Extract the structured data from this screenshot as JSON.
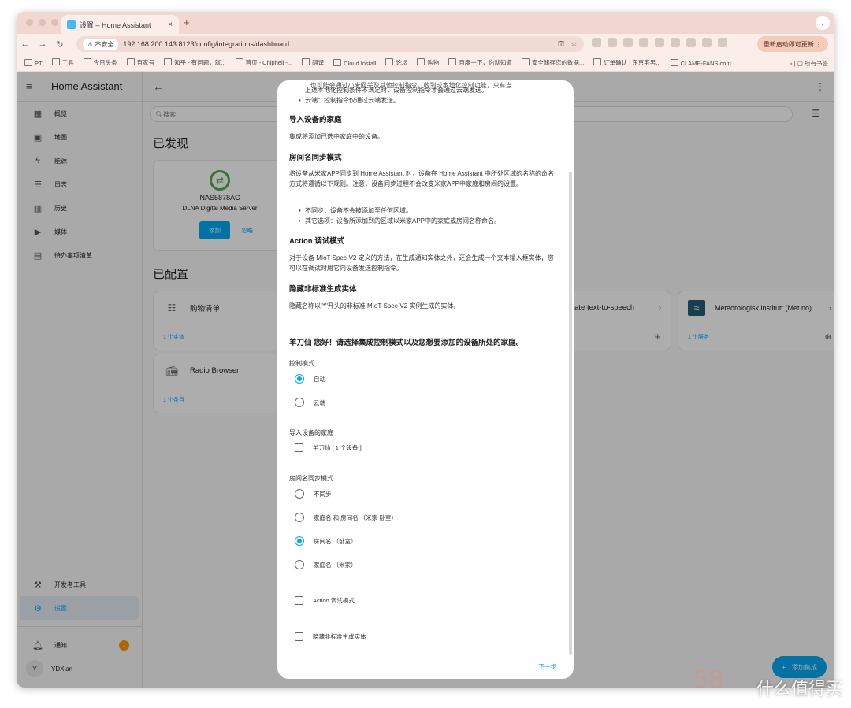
{
  "browser": {
    "tab_title": "设置 – Home Assistant",
    "tab_close": "×",
    "new_tab": "+",
    "insecure_label": "不安全",
    "url": "192.168.200.143:8123/config/integrations/dashboard",
    "relaunch_label": "重新启动即可更新",
    "bookmarks": [
      "PT",
      "工具",
      "今日头条",
      "百家号",
      "知乎 - 有问题，就...",
      "首页 - Chiphell -...",
      "翻译",
      "Cloud Install",
      "论坛",
      "购物",
      "百度一下，你就知道",
      "安全储存您的数据...",
      "订单确认 | 东京宅男...",
      "CLAMP-FANS.com..."
    ],
    "bookmarks_more": "»",
    "all_bookmarks": "所有书签"
  },
  "sidebar": {
    "title": "Home Assistant",
    "items": [
      {
        "label": "概览",
        "icon": "▦"
      },
      {
        "label": "地图",
        "icon": "▣"
      },
      {
        "label": "能源",
        "icon": "ϟ"
      },
      {
        "label": "日志",
        "icon": "☰"
      },
      {
        "label": "历史",
        "icon": "▥"
      },
      {
        "label": "媒体",
        "icon": "▶"
      },
      {
        "label": "待办事项清单",
        "icon": "▤"
      }
    ],
    "dev_tools": "开发者工具",
    "settings": "设置",
    "notifications": "通知",
    "notification_count": "1",
    "user_initial": "Y",
    "user_name": "YDXian"
  },
  "main": {
    "search_placeholder": "搜索",
    "discovered_title": "已发现",
    "configured_title": "已配置",
    "discovered_card": {
      "name": "NAS5878AC",
      "subtitle": "DLNA Digital Media Server",
      "add_label": "添加",
      "ignore_label": "忽略"
    },
    "cards": [
      {
        "name": "购物清单",
        "footer": "1 个实体"
      },
      {
        "name": "Radio Browser",
        "footer": "1 个条目"
      },
      {
        "name": "late text-to-speech",
        "footer": ""
      },
      {
        "name": "Meteorologisk institutt (Met.no)",
        "footer": "1 个服务"
      }
    ],
    "fab_label": "添加集成"
  },
  "dialog": {
    "top_line1": "...也可能会通过小米网关及其他控制指令，收到或本地化控制功能，只有当",
    "top_line2": "上述本地化控制条件不满足时，设备控制指令才会通过云端发送。",
    "top_bullet": "云端：控制指令仅通过云端发送。",
    "sec1_title": "导入设备的家庭",
    "sec1_text": "集成将添加已选中家庭中的设备。",
    "sec2_title": "房间名同步模式",
    "sec2_text": "将设备从米家APP同步到 Home Assistant 时，设备在 Home Assistant 中所处区域的名称的命名方式将遵循以下规则。注意，设备同步过程不会改变米家APP中家庭和房间的设置。",
    "sec2_b1": "不同步：设备不会被添加至任何区域。",
    "sec2_b2": "其它选项：设备所添加到的区域以米家APP中的家庭或房间名称命名。",
    "sec3_title": "Action 调试模式",
    "sec3_text": "对于设备 MIoT-Spec-V2 定义的方法，在生成通知实体之外，还会生成一个文本输入框实体，您可以在调试时用它向设备发送控制指令。",
    "sec4_title": "隐藏非标准生成实体",
    "sec4_text": "隐藏名称以\"*\"开头的非标准 MIoT-Spec-V2 实例生成的实体。",
    "greeting": "羊刀仙 您好！请选择集成控制模式以及您想要添加的设备所处的家庭。",
    "control_mode_label": "控制模式",
    "control_auto": "自动",
    "control_cloud": "云端",
    "home_label": "导入设备的家庭",
    "home_option": "羊刀仙 [ 1 个设备 ]",
    "room_label": "房间名同步模式",
    "room_none": "不同步",
    "room_home_room": "家庭名 和 房间名 （米家 卧室）",
    "room_room": "房间名 （卧室）",
    "room_home": "家庭名 （米家）",
    "action_debug": "Action 调试模式",
    "hide_nonstd": "隐藏非标准生成实体",
    "next_label": "下一步"
  },
  "watermark": {
    "text": "什么值得买",
    "num": "58"
  },
  "colors": {
    "accent": "#03a9f4",
    "badge": "#ff9800",
    "tabstrip": "#f1d7cf"
  }
}
